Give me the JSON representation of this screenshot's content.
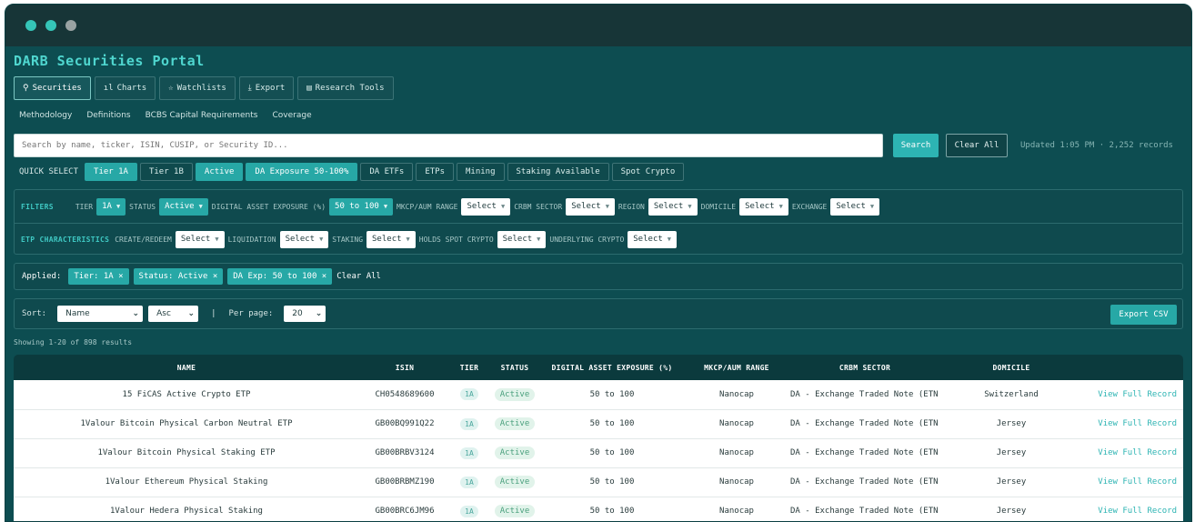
{
  "app": {
    "title": "DARB Securities Portal"
  },
  "window": {
    "dots": [
      "#35c5b8",
      "#35c5b8",
      "#9aa3a3"
    ]
  },
  "tabs": [
    {
      "icon": "search-icon",
      "glyph": "⚲",
      "label": "Securities",
      "active": true
    },
    {
      "icon": "chart-icon",
      "glyph": "ıl",
      "label": "Charts",
      "active": false
    },
    {
      "icon": "star-icon",
      "glyph": "☆",
      "label": "Watchlists",
      "active": false
    },
    {
      "icon": "download-icon",
      "glyph": "⤓",
      "label": "Export",
      "active": false
    },
    {
      "icon": "clipboard-icon",
      "glyph": "▤",
      "label": "Research Tools",
      "active": false
    }
  ],
  "subnav": [
    "Methodology",
    "Definitions",
    "BCBS Capital Requirements",
    "Coverage"
  ],
  "search": {
    "placeholder": "Search by name, ticker, ISIN, CUSIP, or Security ID...",
    "button": "Search",
    "clear": "Clear All",
    "updated": "Updated 1:05 PM · 2,252 records"
  },
  "quick_select": {
    "label": "QUICK SELECT",
    "chips": [
      {
        "label": "Tier 1A",
        "on": true
      },
      {
        "label": "Tier 1B",
        "on": false
      },
      {
        "label": "Active",
        "on": true
      },
      {
        "label": "DA Exposure 50-100%",
        "on": true
      },
      {
        "label": "DA ETFs",
        "on": false
      },
      {
        "label": "ETPs",
        "on": false
      },
      {
        "label": "Mining",
        "on": false
      },
      {
        "label": "Staking Available",
        "on": false
      },
      {
        "label": "Spot Crypto",
        "on": false
      }
    ]
  },
  "filters": {
    "title": "FILTERS",
    "items": [
      {
        "label": "TIER",
        "value": "1A",
        "teal": true
      },
      {
        "label": "STATUS",
        "value": "Active",
        "teal": true
      },
      {
        "label": "DIGITAL ASSET EXPOSURE (%)",
        "value": "50 to 100",
        "teal": true
      },
      {
        "label": "MKCP/AUM RANGE",
        "value": "Select",
        "teal": false
      },
      {
        "label": "CRBM SECTOR",
        "value": "Select",
        "teal": false
      },
      {
        "label": "REGION",
        "value": "Select",
        "teal": false
      },
      {
        "label": "DOMICILE",
        "value": "Select",
        "teal": false
      },
      {
        "label": "EXCHANGE",
        "value": "Select",
        "teal": false
      }
    ]
  },
  "etp": {
    "title": "ETP CHARACTERISTICS",
    "items": [
      {
        "label": "CREATE/REDEEM",
        "value": "Select"
      },
      {
        "label": "LIQUIDATION",
        "value": "Select"
      },
      {
        "label": "STAKING",
        "value": "Select"
      },
      {
        "label": "HOLDS SPOT CRYPTO",
        "value": "Select"
      },
      {
        "label": "UNDERLYING CRYPTO",
        "value": "Select"
      }
    ]
  },
  "applied": {
    "label": "Applied:",
    "tags": [
      "Tier: 1A ×",
      "Status: Active ×",
      "DA Exp: 50 to 100 ×"
    ],
    "clear": "Clear All"
  },
  "sortbar": {
    "sort_label": "Sort:",
    "sort_value": "Name",
    "order_value": "Asc",
    "separator": "|",
    "per_page_label": "Per page:",
    "per_page_value": "20",
    "export": "Export CSV"
  },
  "results": {
    "showing": "Showing 1-20 of 898 results"
  },
  "table": {
    "headers": [
      "NAME",
      "ISIN",
      "TIER",
      "STATUS",
      "DIGITAL ASSET EXPOSURE (%)",
      "MKCP/AUM RANGE",
      "CRBM SECTOR",
      "DOMICILE",
      ""
    ],
    "rows": [
      {
        "name": "15 FiCAS Active Crypto ETP",
        "isin": "CH0548689600",
        "tier": "1A",
        "status": "Active",
        "exposure": "50 to 100",
        "range": "Nanocap",
        "sector": "DA - Exchange Traded Note (ETN)",
        "domicile": "Switzerland",
        "link": "View Full Record"
      },
      {
        "name": "1Valour Bitcoin Physical Carbon Neutral ETP",
        "isin": "GB00BQ991Q22",
        "tier": "1A",
        "status": "Active",
        "exposure": "50 to 100",
        "range": "Nanocap",
        "sector": "DA - Exchange Traded Note (ETN)",
        "domicile": "Jersey",
        "link": "View Full Record"
      },
      {
        "name": "1Valour Bitcoin Physical Staking ETP",
        "isin": "GB00BRBV3124",
        "tier": "1A",
        "status": "Active",
        "exposure": "50 to 100",
        "range": "Nanocap",
        "sector": "DA - Exchange Traded Note (ETN)",
        "domicile": "Jersey",
        "link": "View Full Record"
      },
      {
        "name": "1Valour Ethereum Physical Staking",
        "isin": "GB00BRBMZ190",
        "tier": "1A",
        "status": "Active",
        "exposure": "50 to 100",
        "range": "Nanocap",
        "sector": "DA - Exchange Traded Note (ETN)",
        "domicile": "Jersey",
        "link": "View Full Record"
      },
      {
        "name": "1Valour Hedera Physical Staking",
        "isin": "GB00BRC6JM96",
        "tier": "1A",
        "status": "Active",
        "exposure": "50 to 100",
        "range": "Nanocap",
        "sector": "DA - Exchange Traded Note (ETN)",
        "domicile": "Jersey",
        "link": "View Full Record"
      }
    ]
  }
}
